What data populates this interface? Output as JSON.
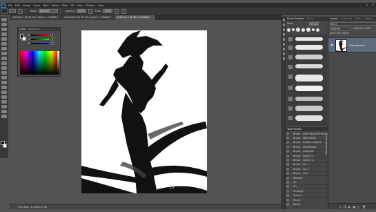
{
  "app": {
    "logo": "Ps",
    "menu": [
      "File",
      "Edit",
      "Image",
      "Layer",
      "Type",
      "Select",
      "Filter",
      "3D",
      "View",
      "Window",
      "Help"
    ],
    "window_controls": [
      "–",
      "□",
      "✕"
    ]
  },
  "options_bar": {
    "mode_label": "Mode:",
    "mode_value": "Normal",
    "opacity_label": "Opacity:",
    "opacity_value": "100%",
    "flow_label": "Flow:",
    "flow_value": "100%"
  },
  "tabs": [
    {
      "label": "Untitled-1 @ 33.3% (Layer 1, RGB/8) *",
      "active": false
    },
    {
      "label": "Untitled-2 @ 16.7% (Layer 1, RGB/8) *",
      "active": false
    },
    {
      "label": "Untitled-3 @ 50% (RGB/8) *",
      "active": true
    }
  ],
  "color_panel": {
    "tabs": [
      "Color",
      "Swatches"
    ],
    "sliders": [
      {
        "label": "R",
        "value": "0"
      },
      {
        "label": "G",
        "value": "0"
      },
      {
        "label": "B",
        "value": "0"
      }
    ]
  },
  "brush_panel": {
    "tabs": [
      "Brush Presets",
      "Brush"
    ],
    "size_label": "Size:",
    "size_value": "55 px",
    "list_header": "Tool Presets",
    "presets": [
      "Brush - Hard Round Pressure",
      "Brush - Wet Media",
      "Brush - Scatter Leaves",
      "Brush - Soft Round",
      "Brush - Charcoal",
      "Brush - Sketch 1",
      "Brush - Sketch 2",
      "Brush - Ink 1",
      "Brush - Ink 2",
      "Brush - Line",
      "Blender",
      "Air",
      "Fill",
      "Smudge",
      "Texture",
      "Pencil",
      "Blend",
      "Eraser",
      "Custom"
    ]
  },
  "layers_panel": {
    "tabs": [
      "Layers",
      "Channels",
      "Paths",
      "History"
    ],
    "filter_label": "Kind",
    "mode_value": "Normal",
    "opacity_text": "Opacity: 100%",
    "lock_text": "Lock:   Fill: 100%",
    "layer_name": "Background",
    "footer_icons": [
      "fx",
      "◐",
      "▣",
      "□",
      "🗑"
    ]
  },
  "status": {
    "zoom_text": "50%    Doc: 11.9M/11.9M"
  }
}
